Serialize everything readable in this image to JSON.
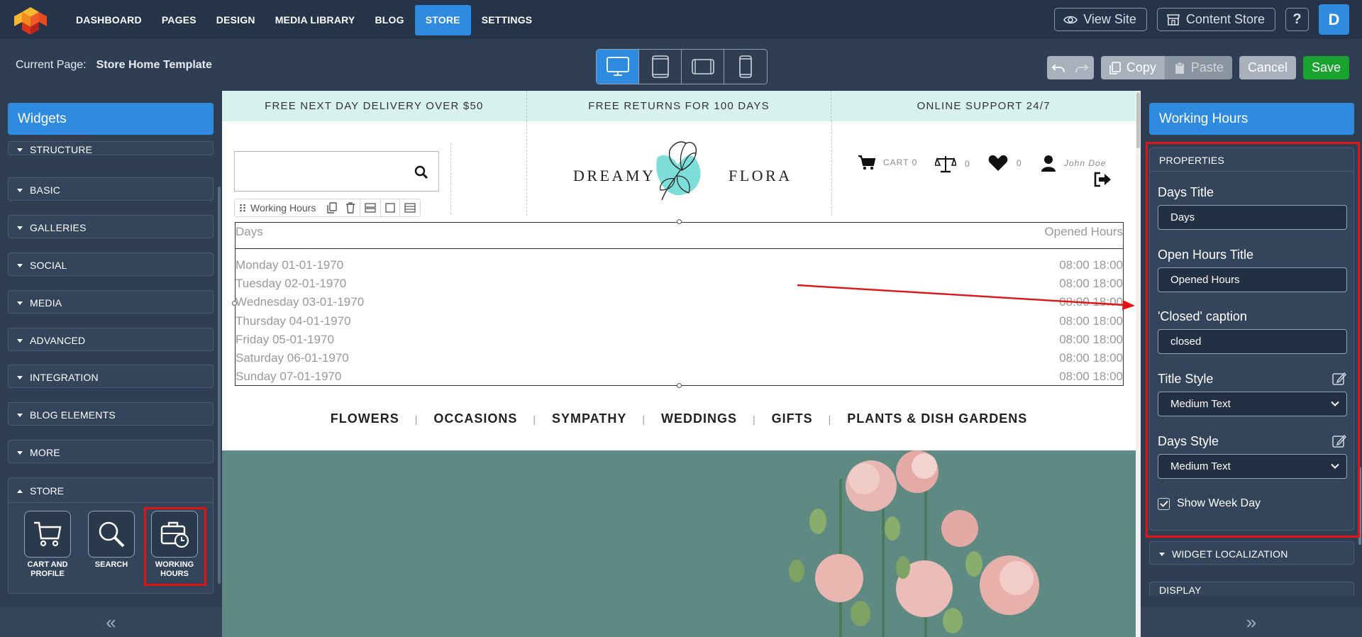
{
  "topnav": {
    "items": [
      "DASHBOARD",
      "PAGES",
      "DESIGN",
      "MEDIA LIBRARY",
      "BLOG",
      "STORE",
      "SETTINGS"
    ],
    "active": "STORE",
    "view_site": "View Site",
    "content_store": "Content Store",
    "help": "?",
    "avatar": "D"
  },
  "pagebar": {
    "label": "Current Page:",
    "page_name": "Store Home Template",
    "undo_icon": "undo-icon",
    "redo_icon": "redo-icon",
    "copy": "Copy",
    "paste": "Paste",
    "cancel": "Cancel",
    "save": "Save",
    "devices": [
      "desktop",
      "tablet",
      "tablet-landscape",
      "mobile"
    ]
  },
  "left": {
    "title": "Widgets",
    "categories": [
      "STRUCTURE",
      "BASIC",
      "GALLERIES",
      "SOCIAL",
      "MEDIA",
      "ADVANCED",
      "INTEGRATION",
      "BLOG ELEMENTS",
      "MORE"
    ],
    "store": {
      "label": "STORE",
      "widgets": [
        {
          "line1": "CART AND",
          "line2": "PROFILE"
        },
        {
          "line1": "SEARCH",
          "line2": ""
        },
        {
          "line1": "WORKING",
          "line2": "HOURS"
        }
      ]
    },
    "collapse": "«"
  },
  "canvas": {
    "strip": [
      "FREE NEXT DAY DELIVERY OVER $50",
      "FREE RETURNS FOR 100 DAYS",
      "ONLINE SUPPORT 24/7"
    ],
    "brand_left": "DREAMY",
    "brand_right": "FLORA",
    "cart": "CART 0",
    "compare_count": "0",
    "wish_count": "0",
    "user": "John Doe",
    "widget_toolbar_label": "Working Hours",
    "working_hours": {
      "days_title": "Days",
      "hours_title": "Opened Hours",
      "rows": [
        {
          "day": "Monday 01-01-1970",
          "hours": "08:00 18:00"
        },
        {
          "day": "Tuesday 02-01-1970",
          "hours": "08:00 18:00"
        },
        {
          "day": "Wednesday 03-01-1970",
          "hours": "08:00 18:00"
        },
        {
          "day": "Thursday 04-01-1970",
          "hours": "08:00 18:00"
        },
        {
          "day": "Friday 05-01-1970",
          "hours": "08:00 18:00"
        },
        {
          "day": "Saturday 06-01-1970",
          "hours": "08:00 18:00"
        },
        {
          "day": "Sunday 07-01-1970",
          "hours": "08:00 18:00"
        }
      ]
    },
    "menu": [
      "FLOWERS",
      "OCCASIONS",
      "SYMPATHY",
      "WEDDINGS",
      "GIFTS",
      "PLANTS & DISH GARDENS"
    ],
    "menu_sep": "|"
  },
  "right": {
    "title": "Working Hours",
    "properties_label": "PROPERTIES",
    "days_title_label": "Days Title",
    "days_title_value": "Days",
    "open_hours_label": "Open Hours Title",
    "open_hours_value": "Opened Hours",
    "closed_label": "'Closed' caption",
    "closed_value": "closed",
    "title_style_label": "Title Style",
    "title_style_value": "Medium Text",
    "days_style_label": "Days Style",
    "days_style_value": "Medium Text",
    "show_week_day": "Show Week Day",
    "show_week_day_checked": true,
    "localization_label": "WIDGET LOCALIZATION",
    "display_label": "DISPLAY",
    "collapse": "»"
  },
  "colors": {
    "accent": "#2e8be0",
    "save": "#17a32e",
    "highlight": "#e01414",
    "strip": "#d7f1ed",
    "hero": "#5f8a84"
  }
}
